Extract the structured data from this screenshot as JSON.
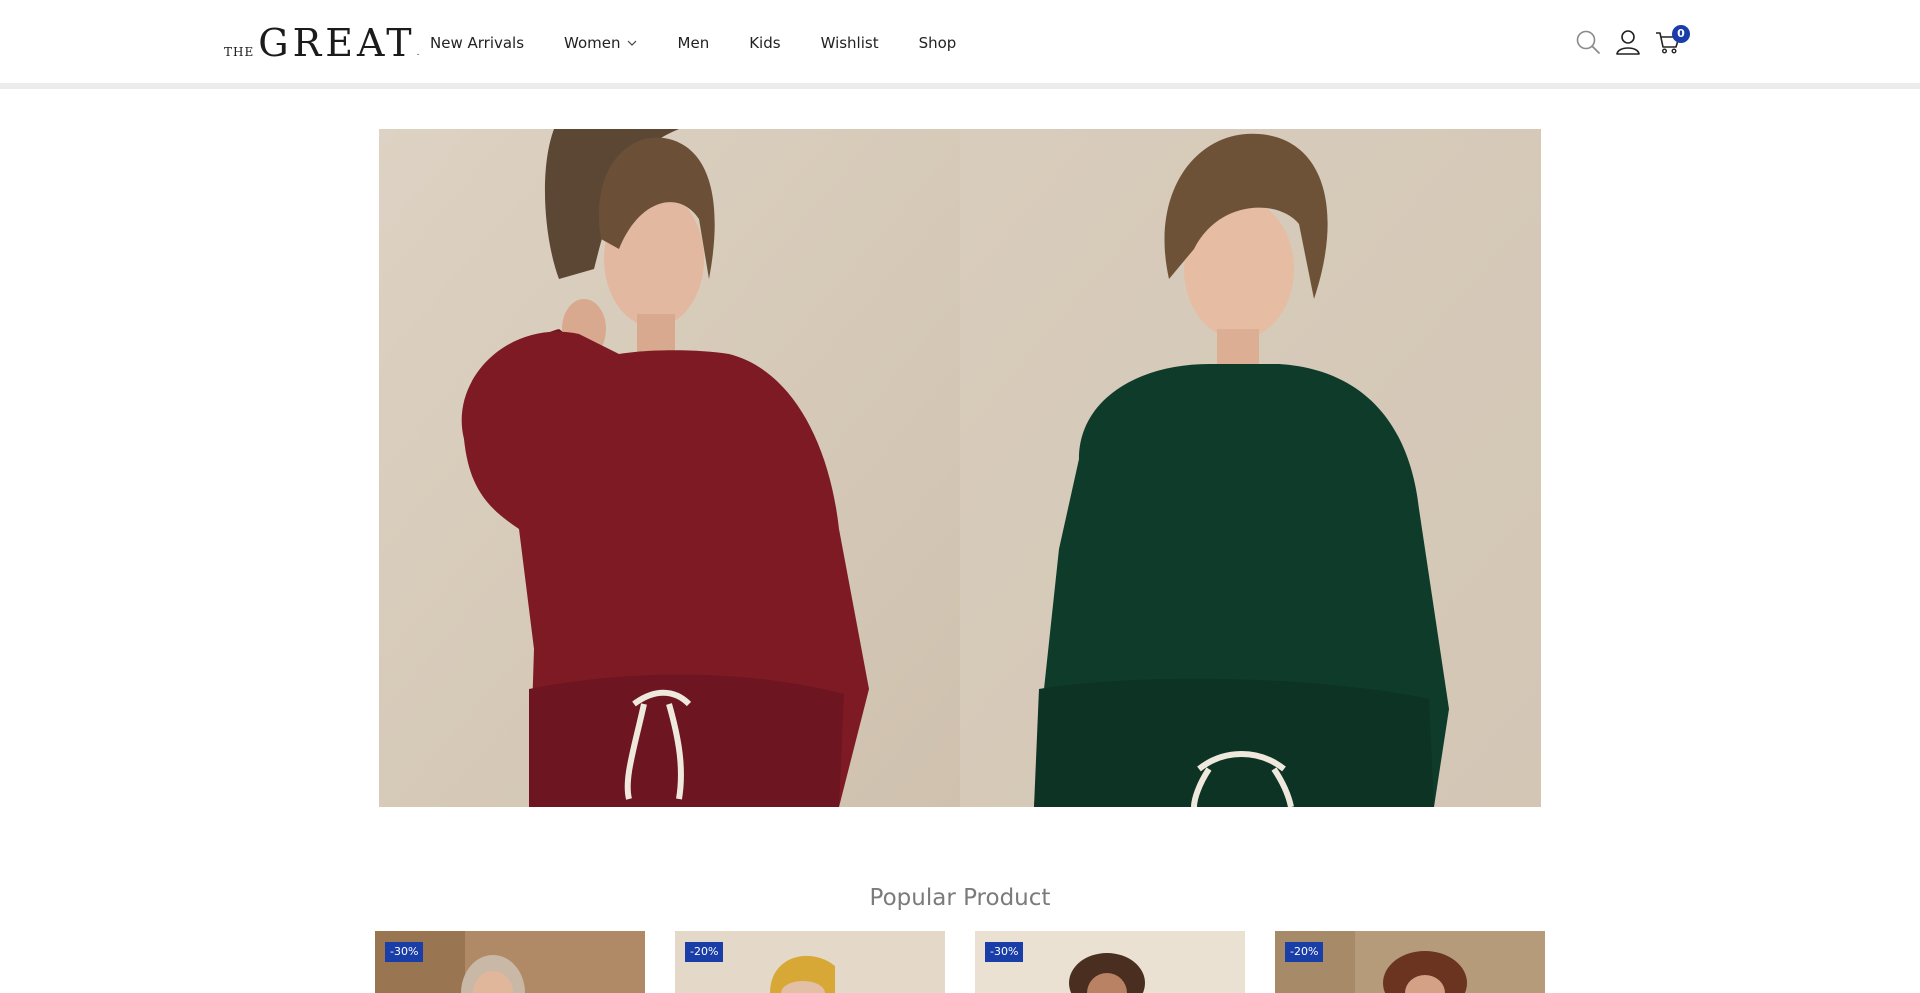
{
  "brand": {
    "the": "THE",
    "great": "GREAT",
    "dot": "."
  },
  "nav": {
    "items": [
      {
        "label": "New Arrivals"
      },
      {
        "label": "Women"
      },
      {
        "label": "Men"
      },
      {
        "label": "Kids"
      },
      {
        "label": "Wishlist"
      },
      {
        "label": "Shop"
      }
    ]
  },
  "header_icons": {
    "search": "search-icon",
    "account": "user-icon",
    "cart": "cart-icon",
    "cart_count": "0"
  },
  "colors": {
    "accent": "#1a3ea8",
    "burgundy": "#7e1a24",
    "forest": "#0f3b2a",
    "backdrop": "#d9cdbd"
  },
  "popular": {
    "title": "Popular Product",
    "products": [
      {
        "discount": "-30%"
      },
      {
        "discount": "-20%"
      },
      {
        "discount": "-30%"
      },
      {
        "discount": "-20%"
      }
    ]
  }
}
